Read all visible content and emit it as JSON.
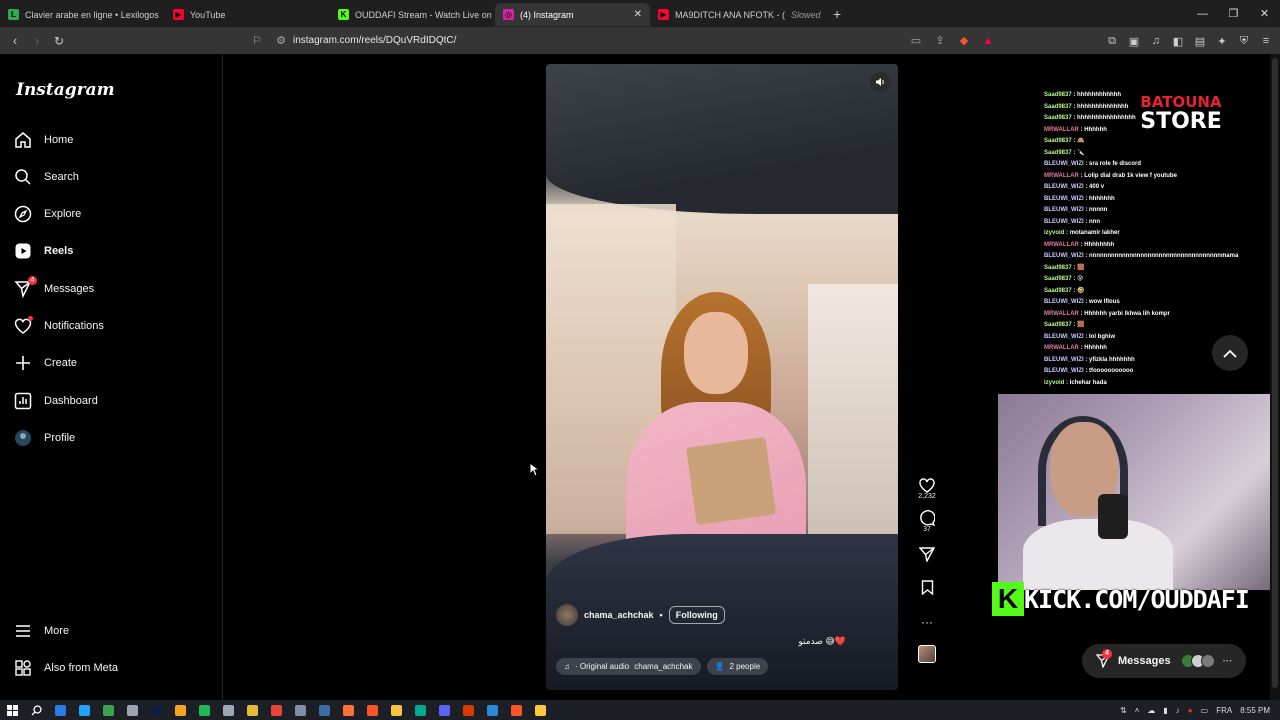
{
  "browser": {
    "tabs": [
      {
        "label": "Clavier arabe en ligne • Lexilogos",
        "color": "#32a852",
        "glyph": "L"
      },
      {
        "label": "YouTube",
        "color": "#ff0033",
        "glyph": "▶"
      },
      {
        "label": "OUDDAFI Stream - Watch Live on Kick",
        "color": "#53fc18",
        "glyph": "K"
      },
      {
        "label": "(4) Instagram",
        "color": "#d6249f",
        "glyph": "◎",
        "active": true
      },
      {
        "label": "MA9DITCH ANA NFOTK - ( ",
        "sublabel": "Slowed",
        "color": "#ff0033",
        "glyph": "▶"
      }
    ],
    "new_tab": "+",
    "url": "instagram.com/reels/DQuVRdIDQtC/"
  },
  "sidebar": {
    "logo": "Instagram",
    "items": [
      {
        "label": "Home",
        "icon": "home-icon"
      },
      {
        "label": "Search",
        "icon": "search-icon"
      },
      {
        "label": "Explore",
        "icon": "compass-icon"
      },
      {
        "label": "Reels",
        "icon": "reels-icon",
        "bold": true
      },
      {
        "label": "Messages",
        "icon": "messenger-icon",
        "badge": "4"
      },
      {
        "label": "Notifications",
        "icon": "heart-icon",
        "dot": true
      },
      {
        "label": "Create",
        "icon": "plus-icon"
      },
      {
        "label": "Dashboard",
        "icon": "dashboard-icon"
      },
      {
        "label": "Profile",
        "icon": "avatar-icon"
      }
    ],
    "more": "More",
    "meta": "Also from Meta"
  },
  "reel": {
    "author": "chama_achchak",
    "separator": "•",
    "follow_state": "Following",
    "caption": "صدمتو 😅❤️",
    "audio_label": "· Original audio",
    "audio_author": "chama_achchak",
    "people": "2 people",
    "likes": "2,232",
    "comments": "37"
  },
  "stream": {
    "store_top": "BATOUNA",
    "store_bottom": "STORE",
    "chat": [
      {
        "user": "Saad9837",
        "cls": "u1",
        "msg": "hhhhhhhhhhhh"
      },
      {
        "user": "Saad9837",
        "cls": "u1",
        "msg": "hhhhhhhhhhhhhh"
      },
      {
        "user": "Saad9837",
        "cls": "u1",
        "msg": "hhhhhhhhhhhhhhhh"
      },
      {
        "user": "MRWALLAR",
        "cls": "u3",
        "msg": "Hhhhhh"
      },
      {
        "user": "Saad9837",
        "cls": "u1",
        "msg": "🙈"
      },
      {
        "user": "Saad9837",
        "cls": "u1",
        "msg": "🔪"
      },
      {
        "user": "BLEUWI_WIZI",
        "cls": "u2",
        "msg": "sra role fe discord"
      },
      {
        "user": "MRWALLAR",
        "cls": "u3",
        "msg": "Lolip dial drab 1k view f youtube"
      },
      {
        "user": "BLEUWI_WIZI",
        "cls": "u2",
        "msg": "400 v"
      },
      {
        "user": "BLEUWI_WIZI",
        "cls": "u2",
        "msg": "hhhhhhh"
      },
      {
        "user": "BLEUWI_WIZI",
        "cls": "u2",
        "msg": "nnnnn"
      },
      {
        "user": "BLEUWI_WIZI",
        "cls": "u2",
        "msg": "nnn"
      },
      {
        "user": "izyvoid",
        "cls": "u1",
        "msg": "motanamir lakher"
      },
      {
        "user": "MRWALLAR",
        "cls": "u3",
        "msg": "Hhhhhhhh"
      },
      {
        "user": "BLEUWI_WIZI",
        "cls": "u2",
        "msg": "nnnnnnnnnnnnnnnnnnnnnnnnnnnnnnnnnnnnmama"
      },
      {
        "user": "Saad9837",
        "cls": "u1",
        "msg": "🟫"
      },
      {
        "user": "Saad9837",
        "cls": "u1",
        "msg": "😰"
      },
      {
        "user": "Saad9837",
        "cls": "u1",
        "msg": "🤣"
      },
      {
        "user": "BLEUWI_WIZI",
        "cls": "u2",
        "msg": "wow lflous"
      },
      {
        "user": "MRWALLAR",
        "cls": "u3",
        "msg": "Hhhhhh yarbi lkhwa lih kompr"
      },
      {
        "user": "Saad9837",
        "cls": "u1",
        "msg": "🟫"
      },
      {
        "user": "BLEUWI_WIZI",
        "cls": "u2",
        "msg": "lol bghiw"
      },
      {
        "user": "MRWALLAR",
        "cls": "u3",
        "msg": "Hhhhhh"
      },
      {
        "user": "BLEUWI_WIZI",
        "cls": "u2",
        "msg": "yfizkla hhhhhhh"
      },
      {
        "user": "BLEUWI_WIZI",
        "cls": "u2",
        "msg": "tfooooooooooo"
      },
      {
        "user": "izyvoid",
        "cls": "u1",
        "msg": "Ichehar hada"
      }
    ],
    "kick_url": "KICK.COM/OUDDAFI"
  },
  "messages_pill": {
    "label": "Messages",
    "badge": "4"
  },
  "taskbar": {
    "lang": "FRA",
    "time": "8:55 PM",
    "apps": [
      "#2a7de1",
      "#1fa3ff",
      "#3ca24c",
      "#9aa5b1",
      "#0d1f3c",
      "#f5a623",
      "#1db954",
      "#9ea7b3",
      "#e2bb36",
      "#ea4335",
      "#7f8fa6",
      "#3a6ea5",
      "#ff7139",
      "#fb542b",
      "#f5c542",
      "#00a98f",
      "#5865f2",
      "#d83b01",
      "#2b88d8",
      "#fb542b",
      "#ffc83d"
    ]
  }
}
